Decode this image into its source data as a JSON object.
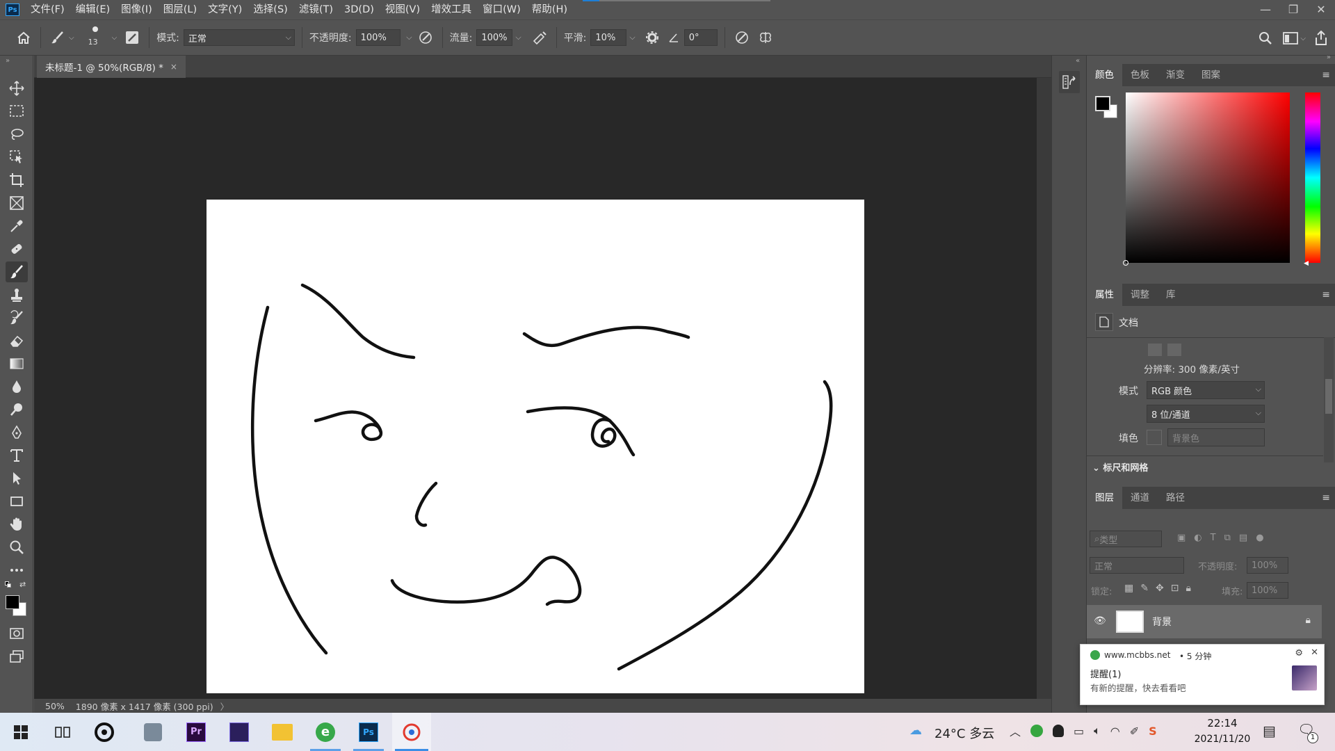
{
  "app": {
    "logo_text": "Ps"
  },
  "menu": [
    "文件(F)",
    "编辑(E)",
    "图像(I)",
    "图层(L)",
    "文字(Y)",
    "选择(S)",
    "滤镜(T)",
    "3D(D)",
    "视图(V)",
    "增效工具",
    "窗口(W)",
    "帮助(H)"
  ],
  "window_controls": {
    "minimize": "—",
    "restore": "❐",
    "close": "✕"
  },
  "options": {
    "brush_size": "13",
    "mode_label": "模式:",
    "mode_value": "正常",
    "opacity_label": "不透明度:",
    "opacity_value": "100%",
    "flow_label": "流量:",
    "flow_value": "100%",
    "smooth_label": "平滑:",
    "smooth_value": "10%",
    "angle_value": "0°"
  },
  "document": {
    "tab_title": "未标题-1 @ 50%(RGB/8) *",
    "tab_close": "×"
  },
  "status": {
    "zoom": "50%",
    "size_info": "1890 像素 x 1417 像素 (300 ppi)",
    "arrow": "〉"
  },
  "panels": {
    "color_tabs": [
      "颜色",
      "色板",
      "渐变",
      "图案"
    ],
    "properties_tabs": [
      "属性",
      "调整",
      "库"
    ],
    "doc_label": "文档",
    "resolution": "分辨率: 300 像素/英寸",
    "mode_label": "模式",
    "mode_value": "RGB 颜色",
    "depth_value": "8 位/通道",
    "fill_label": "填色",
    "fill_value": "背景色",
    "section_ruler": "标尺和网格",
    "layers_tabs": [
      "图层",
      "通道",
      "路径"
    ],
    "layer_search": "类型",
    "blend_mode": "正常",
    "opacity_label": "不透明度:",
    "opacity_value": "100%",
    "lock_label": "锁定:",
    "fill_label2": "填充:",
    "fill_value2": "100%",
    "layer_name": "背景"
  },
  "notification": {
    "site": "www.mcbbs.net",
    "time": "• 5 分钟",
    "title": "提醒(1)",
    "body": "有新的提醒，快去看看吧"
  },
  "taskbar": {
    "weather": "24°C  多云",
    "time": "22:14",
    "date": "2021/11/20",
    "notif_count": "1"
  }
}
